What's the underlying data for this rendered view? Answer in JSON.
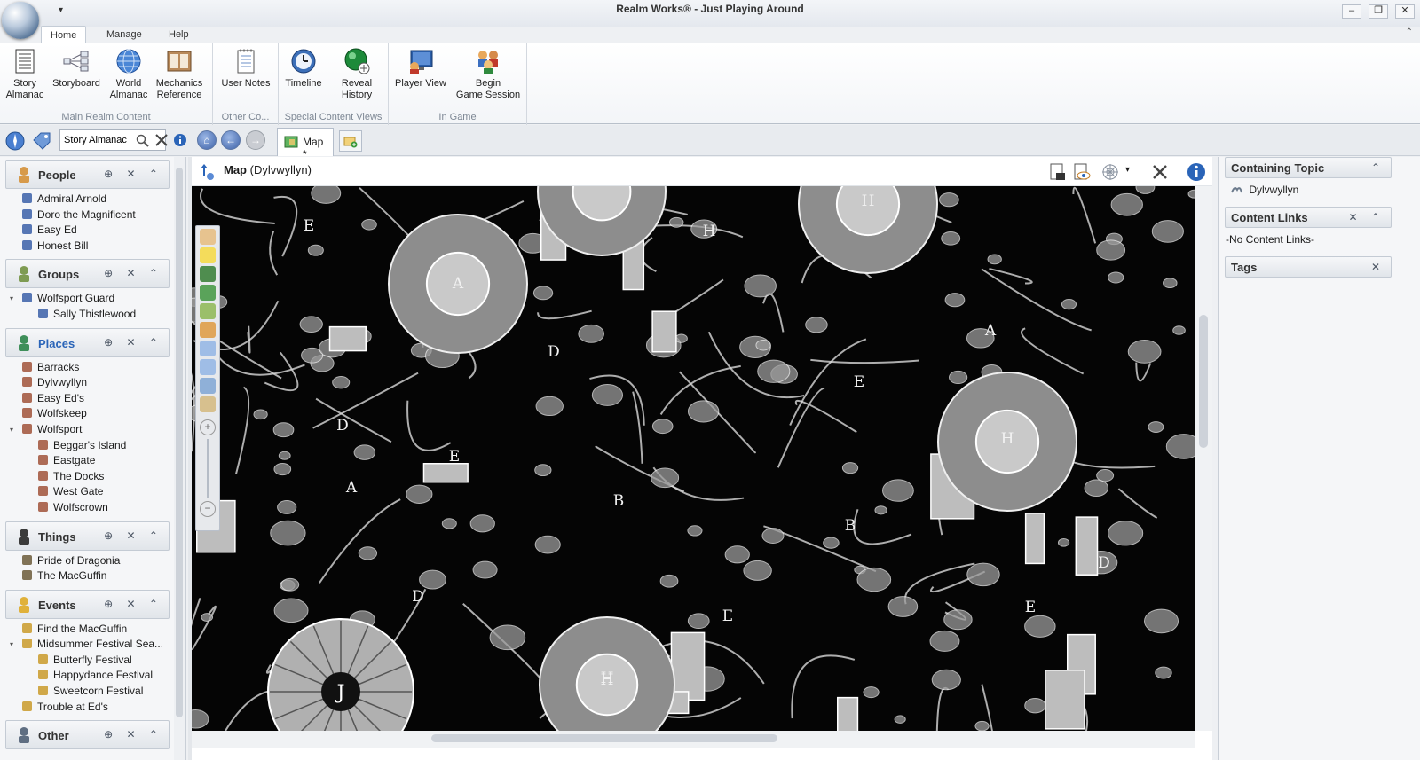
{
  "window": {
    "title": "Realm Works® - Just Playing Around",
    "qat_symbol": "▾",
    "controls": {
      "minimize": "–",
      "restore": "❐",
      "close": "✕"
    },
    "ribbon_collapse": "⌃"
  },
  "ribbon": {
    "tabs": [
      "Home",
      "Manage",
      "Help"
    ],
    "groups": [
      {
        "label": "Main Realm Content",
        "buttons": [
          {
            "line1": "Story",
            "line2": "Almanac",
            "icon": "story-almanac-icon"
          },
          {
            "line1": "Storyboard",
            "line2": "",
            "icon": "storyboard-icon"
          },
          {
            "line1": "World",
            "line2": "Almanac",
            "icon": "world-almanac-icon"
          },
          {
            "line1": "Mechanics",
            "line2": "Reference",
            "icon": "mechanics-reference-icon"
          }
        ]
      },
      {
        "label": "Other Co...",
        "buttons": [
          {
            "line1": "User Notes",
            "line2": "",
            "icon": "user-notes-icon"
          }
        ]
      },
      {
        "label": "Special Content Views",
        "buttons": [
          {
            "line1": "Timeline",
            "line2": "",
            "icon": "timeline-icon"
          },
          {
            "line1": "Reveal",
            "line2": "History",
            "icon": "reveal-history-icon"
          }
        ]
      },
      {
        "label": "In Game",
        "buttons": [
          {
            "line1": "Player View",
            "line2": "",
            "icon": "player-view-icon"
          },
          {
            "line1": "Begin",
            "line2": "Game Session",
            "icon": "begin-game-session-icon"
          }
        ]
      }
    ]
  },
  "navbar": {
    "search_value": "Story Almanac",
    "tab_label": "Map *"
  },
  "sidebar": {
    "categories": [
      {
        "key": "people",
        "label": "People",
        "items": [
          {
            "label": "Admiral Arnold",
            "indent": 0
          },
          {
            "label": "Doro the Magnificent",
            "indent": 0
          },
          {
            "label": "Easy Ed",
            "indent": 0
          },
          {
            "label": "Honest Bill",
            "indent": 0
          }
        ]
      },
      {
        "key": "groups",
        "label": "Groups",
        "items": [
          {
            "label": "Wolfsport Guard",
            "indent": 0,
            "expanded": true
          },
          {
            "label": "Sally Thistlewood",
            "indent": 1
          }
        ]
      },
      {
        "key": "places",
        "label": "Places",
        "selected": true,
        "items": [
          {
            "label": "Barracks",
            "indent": 0
          },
          {
            "label": "Dylvwyllyn",
            "indent": 0
          },
          {
            "label": "Easy Ed's",
            "indent": 0
          },
          {
            "label": "Wolfskeep",
            "indent": 0
          },
          {
            "label": "Wolfsport",
            "indent": 0,
            "expanded": true
          },
          {
            "label": "Beggar's Island",
            "indent": 1
          },
          {
            "label": "Eastgate",
            "indent": 1
          },
          {
            "label": "The Docks",
            "indent": 1
          },
          {
            "label": "West Gate",
            "indent": 1
          },
          {
            "label": "Wolfscrown",
            "indent": 1
          }
        ]
      },
      {
        "key": "things",
        "label": "Things",
        "items": [
          {
            "label": "Pride of Dragonia",
            "indent": 0
          },
          {
            "label": "The MacGuffin",
            "indent": 0
          }
        ]
      },
      {
        "key": "events",
        "label": "Events",
        "items": [
          {
            "label": "Find the MacGuffin",
            "indent": 0
          },
          {
            "label": "Midsummer Festival Sea...",
            "indent": 0,
            "expanded": true
          },
          {
            "label": "Butterfly Festival",
            "indent": 1
          },
          {
            "label": "Happydance Festival",
            "indent": 1
          },
          {
            "label": "Sweetcorn Festival",
            "indent": 1
          },
          {
            "label": "Trouble at Ed's",
            "indent": 0
          }
        ]
      },
      {
        "key": "other",
        "label": "Other",
        "items": []
      }
    ]
  },
  "content": {
    "title": "Map",
    "subtitle": "(Dylvwyllyn)",
    "map_labels": [
      "E",
      "H",
      "A",
      "H",
      "A",
      "H",
      "D",
      "D",
      "E",
      "E",
      "E",
      "H",
      "B",
      "B",
      "A",
      "D",
      "D",
      "E",
      "H",
      "J",
      "E"
    ]
  },
  "rightpanel": {
    "containing_topic": {
      "title": "Containing Topic",
      "value": "Dylvwyllyn"
    },
    "content_links": {
      "title": "Content Links",
      "value": "-No Content Links-"
    },
    "tags": {
      "title": "Tags"
    }
  },
  "colors": {
    "accent": "#2a64b8",
    "map_bg": "#050505",
    "map_stroke": "#d8d8d8"
  }
}
